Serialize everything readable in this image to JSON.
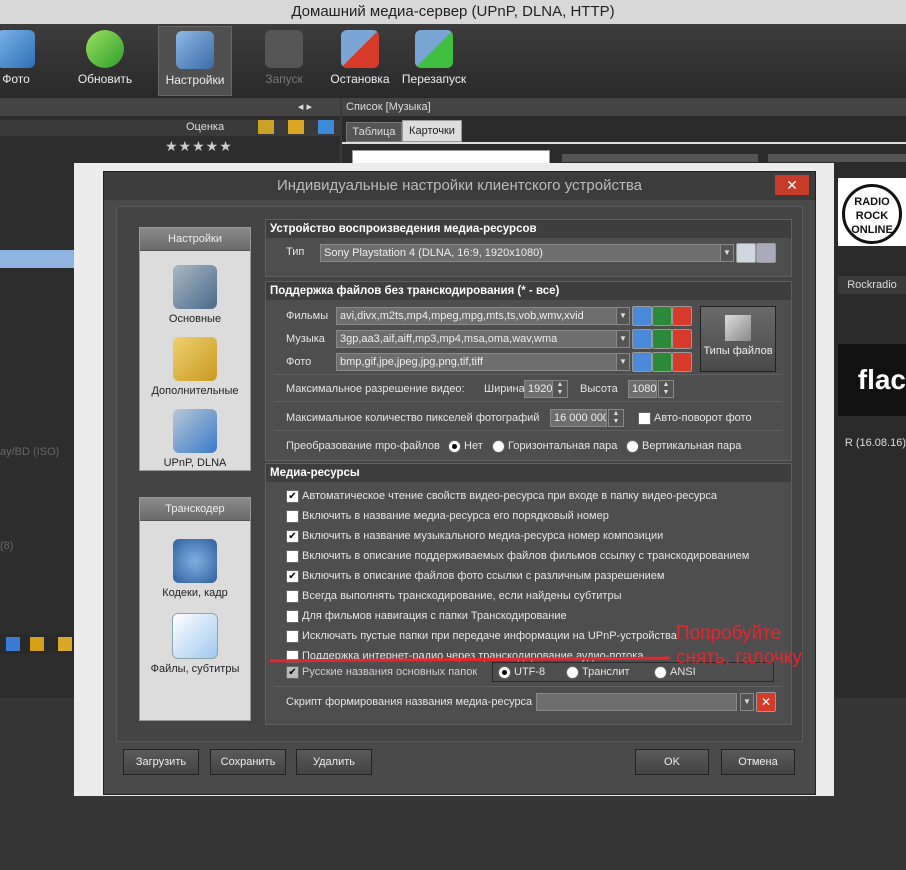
{
  "window_title": "Домашний медиа-сервер (UPnP, DLNA, HTTP)",
  "toolbar": {
    "foto": "Фото",
    "refresh": "Обновить",
    "settings": "Настройки",
    "launch": "Запуск",
    "stop": "Остановка",
    "restart": "Перезапуск"
  },
  "left_panel": {
    "rating_header": "Оценка",
    "fragment1": "ay/BD (ISO)",
    "fragment2": "(8)"
  },
  "right_panel": {
    "list_title": "Список [Музыка]",
    "tab_table": "Таблица",
    "tab_cards": "Карточки",
    "card1_label": "Rockradio",
    "card2_label": "R (16.08.16)",
    "badge_text": "RADIO ROCK ONLINE",
    "flac_text": "flac"
  },
  "dialog": {
    "title": "Индивидуальные настройки клиентского устройства",
    "close": "✕",
    "sidebar_settings": {
      "caption": "Настройки",
      "items": [
        "Основные",
        "Дополнительные",
        "UPnP, DLNA"
      ]
    },
    "sidebar_transcoder": {
      "caption": "Транскодер",
      "items": [
        "Кодеки, кадр",
        "Файлы, субтитры"
      ]
    },
    "device_section": {
      "header": "Устройство воспроизведения медиа-ресурсов",
      "type_label": "Тип",
      "type_value": "Sony Playstation 4 (DLNA, 16:9, 1920x1080)"
    },
    "files_section": {
      "header": "Поддержка файлов без транскодирования (* - все)",
      "movies_label": "Фильмы",
      "movies_value": "avi,divx,m2ts,mp4,mpeg,mpg,mts,ts,vob,wmv,xvid",
      "music_label": "Музыка",
      "music_value": "3gp,aa3,aif,aiff,mp3,mp4,msa,oma,wav,wma",
      "photo_label": "Фото",
      "photo_value": "bmp,gif,jpe,jpeg,jpg,png,tif,tiff",
      "file_types_button": "Типы файлов",
      "max_res_label": "Максимальное разрешение видео:",
      "width_label": "Ширина",
      "width_value": "1920",
      "height_label": "Высота",
      "height_value": "1080",
      "max_pixels_label": "Максимальное количество пикселей фотографий",
      "max_pixels_value": "16 000 000",
      "autorotate_label": "Авто-поворот фото",
      "mpo_label": "Преобразование mpo-файлов",
      "mpo_options": [
        "Нет",
        "Горизонтальная пара",
        "Вертикальная пара"
      ]
    },
    "media_section": {
      "header": "Медиа-ресурсы",
      "options": [
        {
          "label": "Автоматическое чтение свойств видео-ресурса при входе в папку видео-ресурса",
          "checked": true
        },
        {
          "label": "Включить в название медиа-ресурса его порядковый номер",
          "checked": false
        },
        {
          "label": "Включить в название музыкального медиа-ресурса номер композиции",
          "checked": true
        },
        {
          "label": "Включить в описание поддерживаемых файлов фильмов ссылку с транскодированием",
          "checked": false
        },
        {
          "label": "Включить в описание файлов фото ссылки с различным разрешением",
          "checked": true
        },
        {
          "label": "Всегда выполнять транскодирование, если найдены субтитры",
          "checked": false
        },
        {
          "label": "Для фильмов навигация с папки Транскодирование",
          "checked": false
        },
        {
          "label": "Исключать пустые папки при передаче информации на  UPnP-устройства",
          "checked": false
        },
        {
          "label": "Поддержка интернет-радио через транскодирование аудио-потока",
          "checked": false
        }
      ],
      "russian_names_label": "Русские названия основных папок",
      "encoding_options": [
        "UTF-8",
        "Транслит",
        "ANSI"
      ],
      "script_label": "Скрипт формирования названия медиа-ресурса"
    },
    "buttons": {
      "load": "Загрузить",
      "save": "Сохранить",
      "delete": "Удалить",
      "ok": "OK",
      "cancel": "Отмена"
    }
  },
  "annotation": {
    "line1": "Попробуйте",
    "line2": "снять, галочку",
    "color": "#e8242c"
  }
}
